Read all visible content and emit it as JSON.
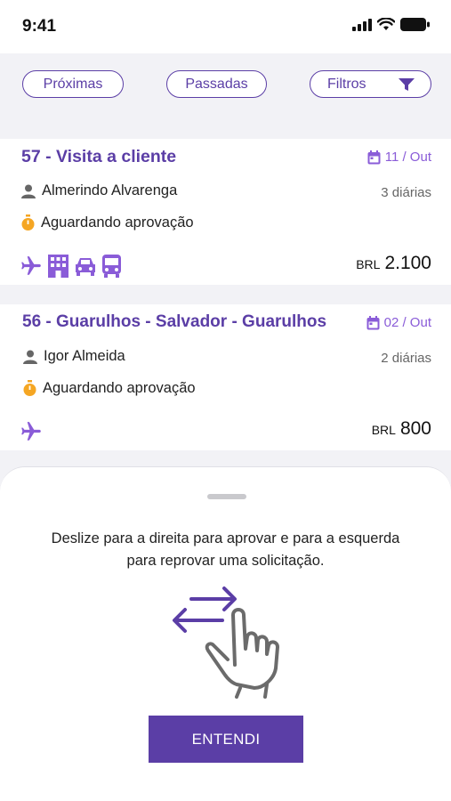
{
  "status_bar": {
    "time": "9:41"
  },
  "filters": {
    "proximas": "Próximas",
    "passadas": "Passadas",
    "filtros": "Filtros"
  },
  "requests": [
    {
      "title": "57 - Visita a cliente",
      "date": "11 / Out",
      "traveler": "Almerindo Alvarenga",
      "diarias": "3 diárias",
      "status": "Aguardando aprovação",
      "modes": [
        "plane-icon",
        "hotel-icon",
        "car-icon",
        "bus-icon"
      ],
      "currency": "BRL",
      "amount": "2.100"
    },
    {
      "title": "56 - Guarulhos - Salvador - Guarulhos",
      "date": "02 / Out",
      "traveler": "Igor Almeida",
      "diarias": "2 diárias",
      "status": "Aguardando aprovação",
      "modes": [
        "plane-icon"
      ],
      "currency": "BRL",
      "amount": "800"
    }
  ],
  "sheet": {
    "instruction": "Deslize para a direita para aprovar e para a esquerda para reprovar uma solicitação.",
    "button": "ENTENDI"
  },
  "colors": {
    "brand": "#5b3ea6",
    "accent": "#8a5cd8",
    "status": "#f5a623"
  }
}
